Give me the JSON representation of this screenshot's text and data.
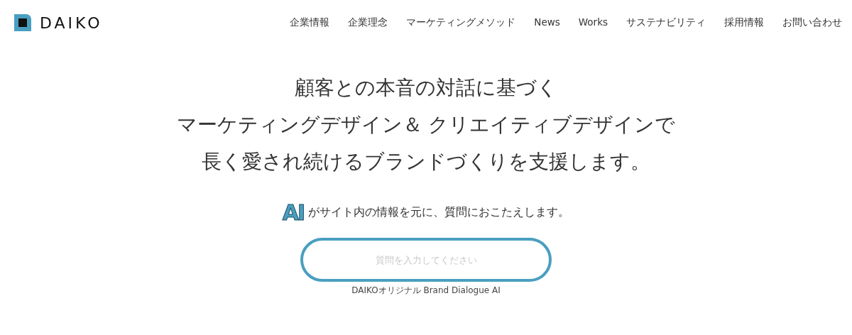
{
  "header": {
    "logo": {
      "text": "DAIKO"
    },
    "nav": [
      "企業情報",
      "企業理念",
      "マーケティングメソッド",
      "News",
      "Works",
      "サステナビリティ",
      "採用情報",
      "お問い合わせ"
    ]
  },
  "hero": {
    "lines": [
      "顧客との本音の対話に基づく",
      "マーケティングデザイン＆ クリエイティブデザインで",
      "長く愛され続けるブランドづくりを支援します。"
    ]
  },
  "ai": {
    "badge": "AI",
    "intro": "がサイト内の情報を元に、質問におこたえします。",
    "placeholder": "質問を入力してください",
    "caption": "DAIKOオリジナル Brand Dialogue AI"
  }
}
